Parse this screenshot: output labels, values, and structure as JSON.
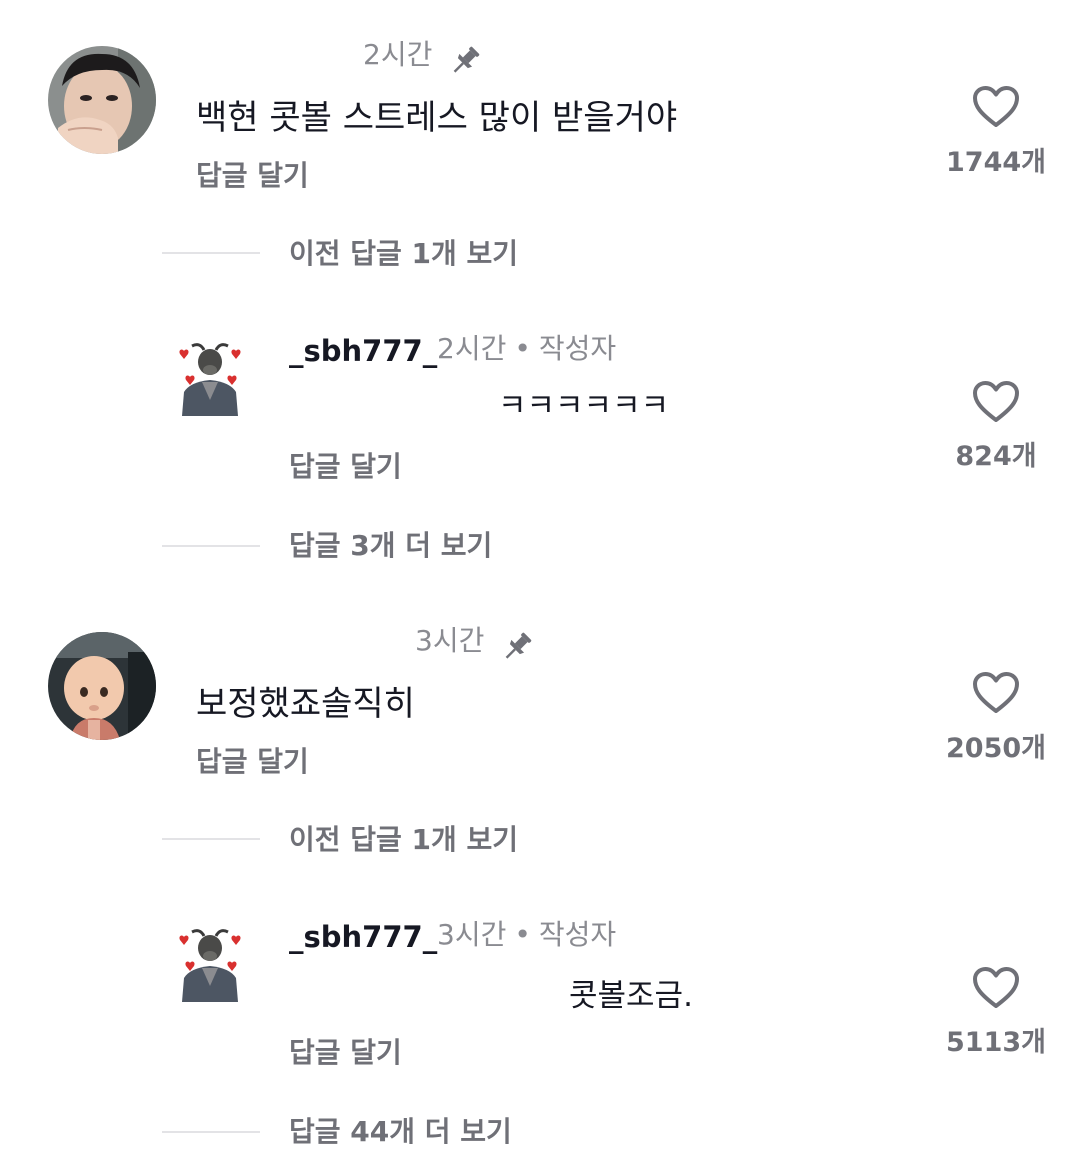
{
  "comments": [
    {
      "time": "2시간",
      "text": "백현 콧볼 스트레스 많이 받을거야",
      "reply_label": "답글 달기",
      "likes": "1744개",
      "view_previous": "이전 답글 1개 보기",
      "reply": {
        "username": "_sbh777_",
        "time": "2시간",
        "author_badge": "작성자",
        "text": "ㅋㅋㅋㅋㅋㅋ",
        "reply_label": "답글 달기",
        "likes": "824개"
      },
      "view_more": "답글 3개 더 보기"
    },
    {
      "time": "3시간",
      "text": "보정했죠솔직히",
      "reply_label": "답글 달기",
      "likes": "2050개",
      "view_previous": "이전 답글 1개 보기",
      "reply": {
        "username": "_sbh777_",
        "time": "3시간",
        "author_badge": "작성자",
        "text": "콧볼조금.",
        "reply_label": "답글 달기",
        "likes": "5113개"
      },
      "view_more": "답글 44개 더 보기"
    }
  ],
  "icons": {
    "pin": "pin-icon",
    "heart": "heart-outline-icon"
  },
  "colors": {
    "text_primary": "#161823",
    "text_secondary": "#6f7077",
    "text_muted": "#8a8b91"
  }
}
